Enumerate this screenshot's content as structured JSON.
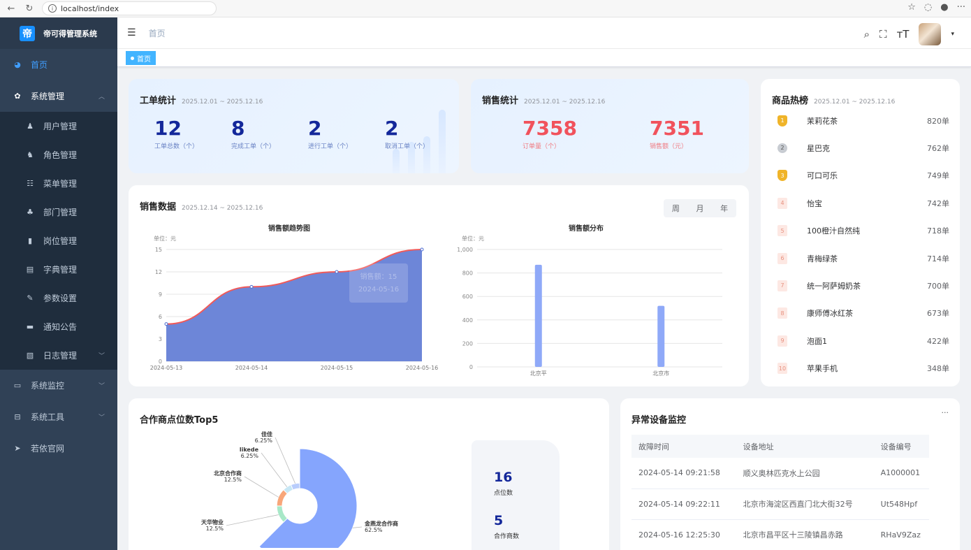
{
  "browser": {
    "url": "localhost/index"
  },
  "sidebar": {
    "logo_text": "帝可得管理系统",
    "logo_mark": "帝",
    "items": [
      {
        "label": "首页",
        "icon": "dashboard-icon",
        "glyph": "◕"
      },
      {
        "label": "系统管理",
        "icon": "gear-icon",
        "glyph": "✿"
      },
      {
        "label": "用户管理",
        "icon": "user-icon",
        "glyph": "♟"
      },
      {
        "label": "角色管理",
        "icon": "peoples-icon",
        "glyph": "♞"
      },
      {
        "label": "菜单管理",
        "icon": "tree-table-icon",
        "glyph": "☷"
      },
      {
        "label": "部门管理",
        "icon": "tree-icon",
        "glyph": "♣"
      },
      {
        "label": "岗位管理",
        "icon": "post-icon",
        "glyph": "▮"
      },
      {
        "label": "字典管理",
        "icon": "dict-icon",
        "glyph": "▤"
      },
      {
        "label": "参数设置",
        "icon": "edit-icon",
        "glyph": "✎"
      },
      {
        "label": "通知公告",
        "icon": "message-icon",
        "glyph": "▬"
      },
      {
        "label": "日志管理",
        "icon": "log-icon",
        "glyph": "▧"
      },
      {
        "label": "系统监控",
        "icon": "monitor-icon",
        "glyph": "▭"
      },
      {
        "label": "系统工具",
        "icon": "tool-icon",
        "glyph": "⊟"
      },
      {
        "label": "若依官网",
        "icon": "guide-icon",
        "glyph": "➤"
      }
    ]
  },
  "navbar": {
    "breadcrumb": "首页",
    "tag": "首页"
  },
  "workorder": {
    "title": "工单统计",
    "range": "2025.12.01 ~ 2025.12.16",
    "stats": [
      {
        "value": "12",
        "label": "工单总数（个）"
      },
      {
        "value": "8",
        "label": "完成工单（个）"
      },
      {
        "value": "2",
        "label": "进行工单（个）"
      },
      {
        "value": "2",
        "label": "取消工单（个）"
      }
    ]
  },
  "sales": {
    "title": "销售统计",
    "range": "2025.12.01 ~ 2025.12.16",
    "stats": [
      {
        "value": "7358",
        "label": "订单量（个）"
      },
      {
        "value": "7351",
        "label": "销售额（元）"
      }
    ]
  },
  "sales_data": {
    "title": "销售数据",
    "range": "2025.12.14 ~ 2025.12.16",
    "periods": [
      "周",
      "月",
      "年"
    ]
  },
  "chart_data": [
    {
      "type": "area",
      "title": "销售额趋势图",
      "unit_label": "单位：元",
      "x": [
        "2024-05-13",
        "2024-05-14",
        "2024-05-15",
        "2024-05-16"
      ],
      "values": [
        5,
        10,
        12,
        15
      ],
      "ylim": [
        0,
        15
      ],
      "yticks": [
        0,
        3,
        6,
        9,
        12,
        15
      ],
      "tooltip": [
        "销售额：15",
        "2024-05-16"
      ],
      "colors": {
        "fill": "#6d86d8",
        "line": "#f05a5a"
      }
    },
    {
      "type": "bar",
      "title": "销售额分布",
      "unit_label": "单位：元",
      "categories": [
        "北京市",
        "北京市"
      ],
      "tick_labels": [
        "北京平",
        "北京市"
      ],
      "values": [
        870,
        520
      ],
      "ylim": [
        0,
        1000
      ],
      "yticks": [
        "0",
        "200",
        "400",
        "600",
        "800",
        "1,000"
      ],
      "colors": {
        "bar": "#8fa9f8"
      }
    },
    {
      "type": "pie",
      "title": "合作商点位数Top5",
      "slices": [
        {
          "name": "金燕龙合作商",
          "pct": "62.5%",
          "value": 62.5,
          "color": "#85a5fd"
        },
        {
          "name": "天华物业",
          "pct": "12.5%",
          "value": 12.5,
          "color": "#a8e8c8"
        },
        {
          "name": "北京合作商",
          "pct": "12.5%",
          "value": 12.5,
          "color": "#f8a67a"
        },
        {
          "name": "likede",
          "pct": "6.25%",
          "value": 6.25,
          "color": "#c7e7f5"
        },
        {
          "name": "佳佳",
          "pct": "6.25%",
          "value": 6.25,
          "color": "#b9cdfc"
        }
      ]
    }
  ],
  "hot": {
    "title": "商品热榜",
    "range": "2025.12.01 ~ 2025.12.16",
    "items": [
      {
        "rank": "1",
        "name": "茉莉花茶",
        "value": "820单"
      },
      {
        "rank": "2",
        "name": "星巴克",
        "value": "762单"
      },
      {
        "rank": "3",
        "name": "可口可乐",
        "value": "749单"
      },
      {
        "rank": "4",
        "name": "怡宝",
        "value": "742单"
      },
      {
        "rank": "5",
        "name": "100橙汁自然纯",
        "value": "718单"
      },
      {
        "rank": "6",
        "name": "青梅绿茶",
        "value": "714单"
      },
      {
        "rank": "7",
        "name": "统一阿萨姆奶茶",
        "value": "700单"
      },
      {
        "rank": "8",
        "name": "康师傅冰红茶",
        "value": "673单"
      },
      {
        "rank": "9",
        "name": "泡面1",
        "value": "422单"
      },
      {
        "rank": "10",
        "name": "苹果手机",
        "value": "348单"
      }
    ]
  },
  "partner": {
    "title": "合作商点位数Top5",
    "stats": [
      {
        "value": "16",
        "label": "点位数"
      },
      {
        "value": "5",
        "label": "合作商数"
      }
    ]
  },
  "devices": {
    "title": "异常设备监控",
    "more": "···",
    "columns": [
      "故障时间",
      "设备地址",
      "设备编号"
    ],
    "rows": [
      [
        "2024-05-14 09:21:58",
        "顺义奥林匹克水上公园",
        "A1000001"
      ],
      [
        "2024-05-14 09:22:11",
        "北京市海淀区西直门北大街32号",
        "Ut548Hpf"
      ],
      [
        "2024-05-16 12:25:30",
        "北京市昌平区十三陵镇昌赤路",
        "RHaV9Zaz"
      ]
    ]
  }
}
